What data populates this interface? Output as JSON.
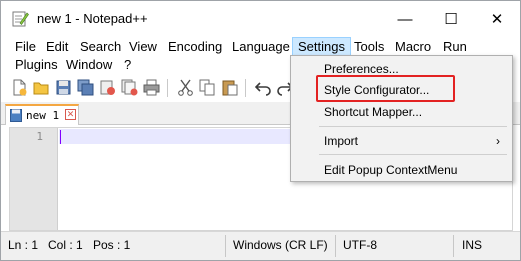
{
  "window": {
    "title": "new 1 - Notepad++",
    "minimize_glyph": "—",
    "maximize_glyph": "☐",
    "close_glyph": "✕"
  },
  "menubar": {
    "row1": [
      "File",
      "Edit",
      "Search",
      "View",
      "Encoding",
      "Language",
      "Settings",
      "Tools",
      "Macro",
      "Run"
    ],
    "row2": [
      "Plugins",
      "Window",
      "?"
    ],
    "active": "Settings"
  },
  "toolbar": {
    "icons": [
      "new-file-icon",
      "open-file-icon",
      "save-icon",
      "save-all-icon",
      "close-icon",
      "close-all-icon",
      "print-icon",
      "cut-icon",
      "copy-icon",
      "paste-icon",
      "undo-icon",
      "redo-icon"
    ]
  },
  "tabs": [
    {
      "label": "new 1",
      "close_glyph": "✕"
    }
  ],
  "editor": {
    "line_numbers": [
      "1"
    ]
  },
  "settings_menu": {
    "items": [
      {
        "label": "Preferences..."
      },
      {
        "label": "Style Configurator..."
      },
      {
        "label": "Shortcut Mapper..."
      },
      {
        "label": "Import",
        "arrow": "›"
      },
      {
        "label": "Edit Popup ContextMenu"
      }
    ],
    "highlighted_item": "Style Configurator...",
    "highlight_color": "#e32222"
  },
  "statusbar": {
    "ln": "Ln : 1",
    "col": "Col : 1",
    "pos": "Pos : 1",
    "eol": "Windows (CR LF)",
    "encoding": "UTF-8",
    "mode": "INS"
  },
  "colors": {
    "accent_tab": "#f4a742",
    "menu_active_bg": "#cce8ff",
    "caret": "#8000ff"
  }
}
